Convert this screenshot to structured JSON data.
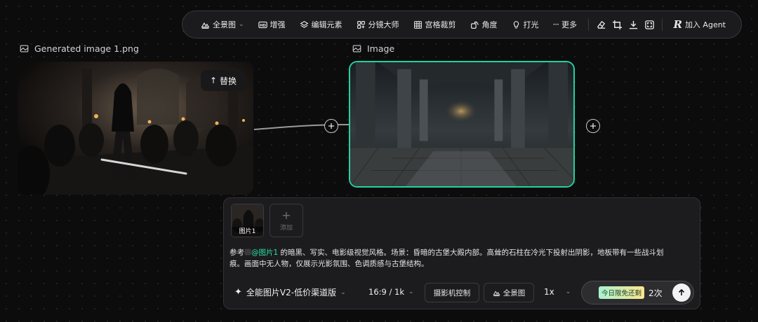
{
  "toolbar": {
    "panorama": "全景图",
    "enhance": "增强",
    "edit_elements": "编辑元素",
    "storyboard": "分镜大师",
    "grid_crop": "宫格裁剪",
    "angle": "角度",
    "lighting": "打光",
    "more": "更多",
    "join_agent": "加入 Agent",
    "icons": [
      "panorama-icon",
      "hd-icon",
      "layers-icon",
      "storyboard-icon",
      "grid-icon",
      "angle-icon",
      "bulb-icon",
      "more-dots-icon",
      "eraser-icon",
      "crop-icon",
      "download-icon",
      "fullscreen-icon",
      "agent-logo-icon"
    ]
  },
  "nodes": {
    "left_title": "Generated image 1.png",
    "right_title": "Image",
    "replace_label": "替换"
  },
  "panel": {
    "thumb_label": "图片1",
    "add_label": "添加",
    "prompt_prefix": "参考",
    "mention": "@图片1",
    "prompt_body": " 的暗黑、写实、电影级视觉风格。场景：昏暗的古堡大殿内部。高耸的石柱在冷光下投射出阴影，地板带有一些战斗划痕。画面中无人物，仅展示光影氛围、色调质感与古堡结构。",
    "model": "全能图片V2-低价渠道版",
    "ratio": "16:9 / 1k",
    "camera_control": "摄影机控制",
    "panorama": "全景图",
    "count": "1x",
    "free_badge": "今日限免还剩",
    "free_count": "2次"
  },
  "colors": {
    "accent": "#1fd3a0",
    "mention": "#2ee0a8",
    "background": "#0c0c0d",
    "panel": "#1c1c1e"
  }
}
